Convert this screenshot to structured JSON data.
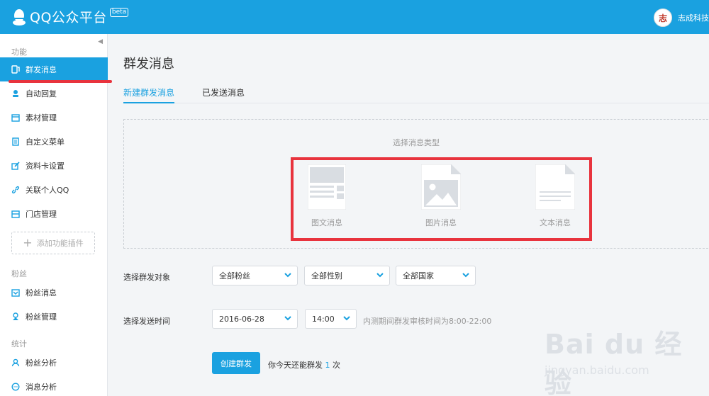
{
  "app": {
    "name": "QQ公众平台",
    "beta": "beta"
  },
  "user": {
    "avatar_text": "志",
    "name": "志成科技"
  },
  "sidebar": {
    "sections": [
      {
        "title": "功能"
      },
      {
        "title": "粉丝"
      },
      {
        "title": "统计"
      }
    ],
    "items": [
      {
        "label": "群发消息",
        "icon": "phone-message-icon",
        "active": true
      },
      {
        "label": "自动回复",
        "icon": "robot-icon"
      },
      {
        "label": "素材管理",
        "icon": "folder-icon"
      },
      {
        "label": "自定义菜单",
        "icon": "menu-doc-icon"
      },
      {
        "label": "资料卡设置",
        "icon": "edit-card-icon"
      },
      {
        "label": "关联个人QQ",
        "icon": "link-icon"
      },
      {
        "label": "门店管理",
        "icon": "store-icon"
      },
      {
        "label": "粉丝消息",
        "icon": "inbox-icon"
      },
      {
        "label": "粉丝管理",
        "icon": "fans-icon"
      },
      {
        "label": "粉丝分析",
        "icon": "user-icon"
      },
      {
        "label": "消息分析",
        "icon": "chat-icon"
      }
    ],
    "add_plugin": "添加功能插件"
  },
  "main": {
    "title": "群发消息",
    "tabs": [
      {
        "label": "新建群发消息",
        "active": true
      },
      {
        "label": "已发送消息"
      }
    ],
    "message_type": {
      "caption": "选择消息类型",
      "options": [
        {
          "label": "图文消息",
          "icon": "article-icon"
        },
        {
          "label": "图片消息",
          "icon": "image-icon"
        },
        {
          "label": "文本消息",
          "icon": "text-icon"
        }
      ]
    },
    "target": {
      "label": "选择群发对象",
      "fans": "全部粉丝",
      "gender": "全部性别",
      "country": "全部国家"
    },
    "schedule": {
      "label": "选择发送时间",
      "date": "2016-06-28",
      "time": "14:00",
      "hint": "内测期间群发审核时间为8:00-22:00"
    },
    "submit": "创建群发",
    "quota": {
      "prefix": "你今天还能群发",
      "count": "1",
      "suffix": "次"
    }
  },
  "watermark": {
    "logo": "Bai du 经验",
    "url": "jingyan.baidu.com"
  },
  "colors": {
    "primary": "#1aa1e0",
    "highlight": "#e8333d"
  }
}
